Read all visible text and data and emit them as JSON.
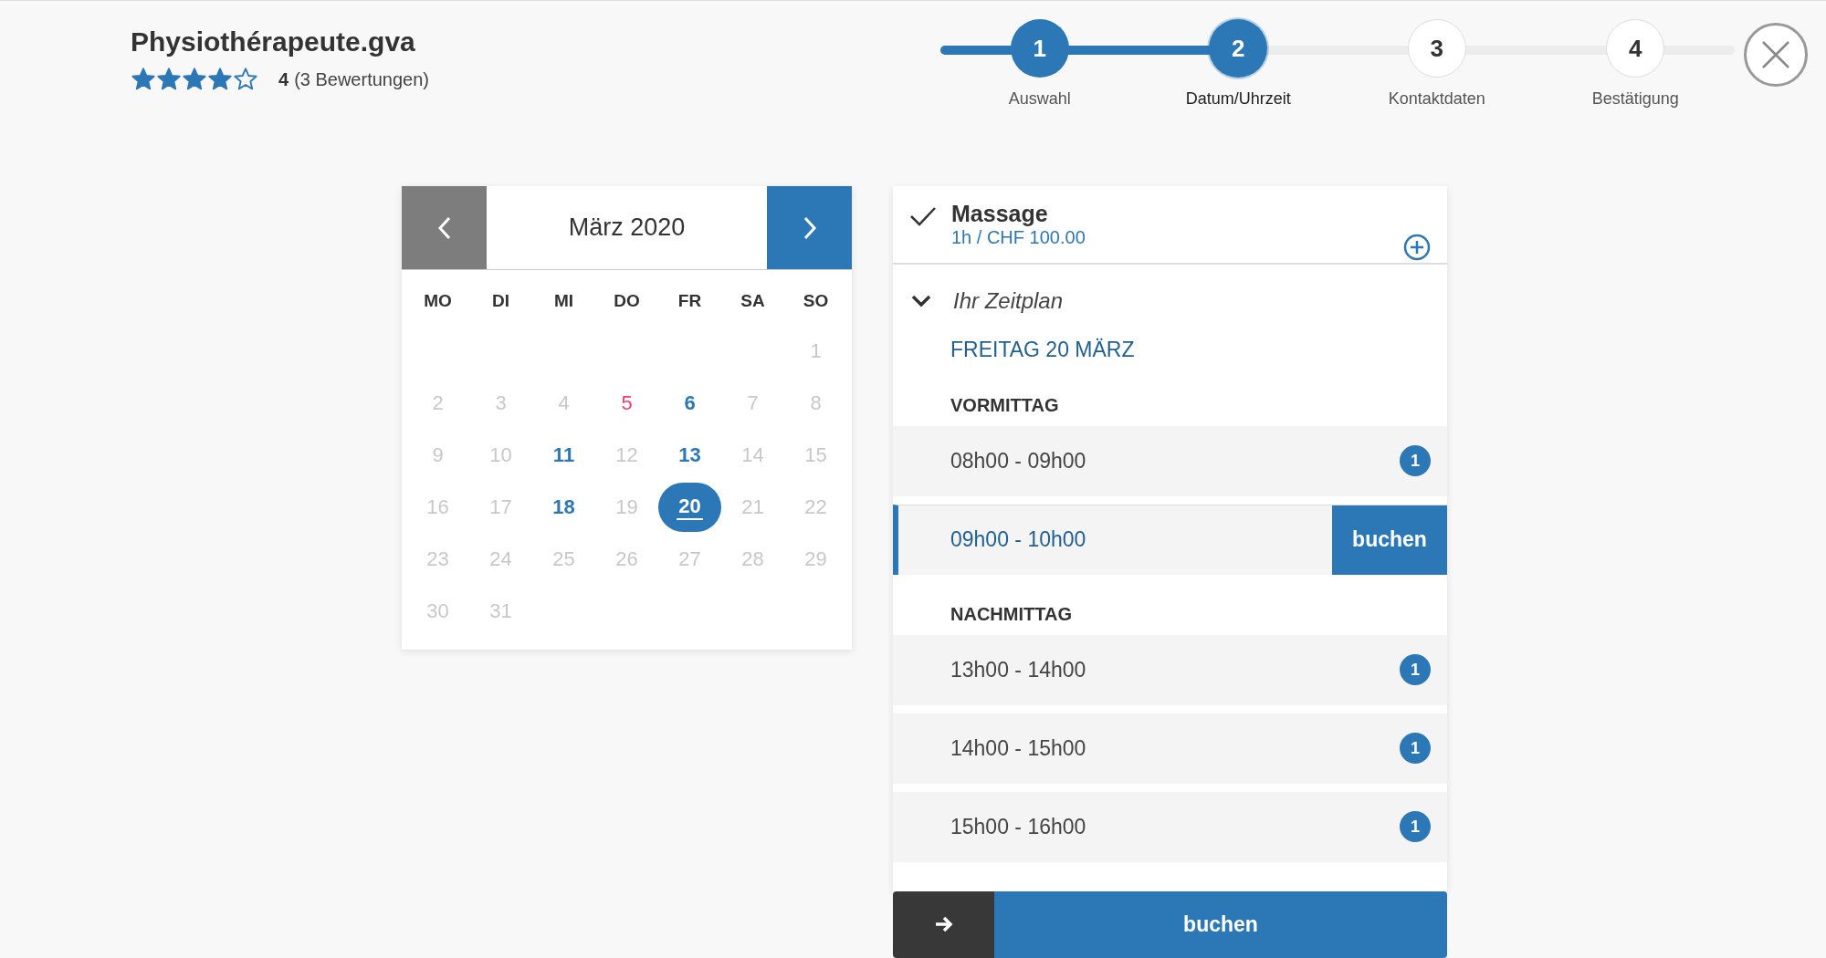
{
  "provider": {
    "name": "Physiothérapeute.gva",
    "stars": 4,
    "rating": "4",
    "reviews": "(3 Bewertungen)"
  },
  "steps": [
    {
      "number": "1",
      "label": "Auswahl",
      "completed": true,
      "selected": false
    },
    {
      "number": "2",
      "label": "Datum/Uhrzeit",
      "completed": true,
      "selected": true
    },
    {
      "number": "3",
      "label": "Kontaktdaten",
      "completed": false,
      "selected": false
    },
    {
      "number": "4",
      "label": "Bestätigung",
      "completed": false,
      "selected": false
    }
  ],
  "calendar": {
    "month": "März 2020",
    "weekdays": [
      "MO",
      "DI",
      "MI",
      "DO",
      "FR",
      "SA",
      "SO"
    ],
    "weeks": [
      [
        {
          "day": "1",
          "kind": "unavailable",
          "selected": false
        }
      ],
      [
        {
          "day": "2",
          "kind": "unavailable",
          "selected": false
        },
        {
          "day": "3",
          "kind": "unavailable",
          "selected": false
        },
        {
          "day": "4",
          "kind": "unavailable",
          "selected": false
        },
        {
          "day": "5",
          "kind": "today",
          "selected": false
        },
        {
          "day": "6",
          "kind": "available",
          "selected": false
        },
        {
          "day": "7",
          "kind": "unavailable",
          "selected": false
        },
        {
          "day": "8",
          "kind": "unavailable",
          "selected": false
        }
      ],
      [
        {
          "day": "9",
          "kind": "unavailable",
          "selected": false
        },
        {
          "day": "10",
          "kind": "unavailable",
          "selected": false
        },
        {
          "day": "11",
          "kind": "available",
          "selected": false
        },
        {
          "day": "12",
          "kind": "unavailable",
          "selected": false
        },
        {
          "day": "13",
          "kind": "available",
          "selected": false
        },
        {
          "day": "14",
          "kind": "unavailable",
          "selected": false
        },
        {
          "day": "15",
          "kind": "unavailable",
          "selected": false
        }
      ],
      [
        {
          "day": "16",
          "kind": "unavailable",
          "selected": false
        },
        {
          "day": "17",
          "kind": "unavailable",
          "selected": false
        },
        {
          "day": "18",
          "kind": "available",
          "selected": false
        },
        {
          "day": "19",
          "kind": "unavailable",
          "selected": false
        },
        {
          "day": "20",
          "kind": "available",
          "selected": true
        },
        {
          "day": "21",
          "kind": "unavailable",
          "selected": false
        },
        {
          "day": "22",
          "kind": "unavailable",
          "selected": false
        }
      ],
      [
        {
          "day": "23",
          "kind": "unavailable",
          "selected": false
        },
        {
          "day": "24",
          "kind": "unavailable",
          "selected": false
        },
        {
          "day": "25",
          "kind": "unavailable",
          "selected": false
        },
        {
          "day": "26",
          "kind": "unavailable",
          "selected": false
        },
        {
          "day": "27",
          "kind": "unavailable",
          "selected": false
        },
        {
          "day": "28",
          "kind": "unavailable",
          "selected": false
        },
        {
          "day": "29",
          "kind": "unavailable",
          "selected": false
        }
      ],
      [
        {
          "day": "30",
          "kind": "unavailable",
          "selected": false
        },
        {
          "day": "31",
          "kind": "unavailable",
          "selected": false
        }
      ]
    ]
  },
  "service": {
    "name": "Massage",
    "details": "1h / CHF 100.00"
  },
  "schedule": {
    "title": "Ihr Zeitplan",
    "expanded": true,
    "date": "FREITAG 20 MÄRZ",
    "groups": [
      {
        "title": "VORMITTAG",
        "slots": [
          {
            "time": "08h00 - 09h00",
            "selected": false,
            "count": "1"
          },
          {
            "time": "09h00 - 10h00",
            "selected": true,
            "button": "buchen"
          }
        ]
      },
      {
        "title": "NACHMITTAG",
        "slots": [
          {
            "time": "13h00 - 14h00",
            "selected": false,
            "count": "1"
          },
          {
            "time": "14h00 - 15h00",
            "selected": false,
            "count": "1"
          },
          {
            "time": "15h00 - 16h00",
            "selected": false,
            "count": "1"
          }
        ]
      }
    ]
  },
  "book_button": "buchen"
}
